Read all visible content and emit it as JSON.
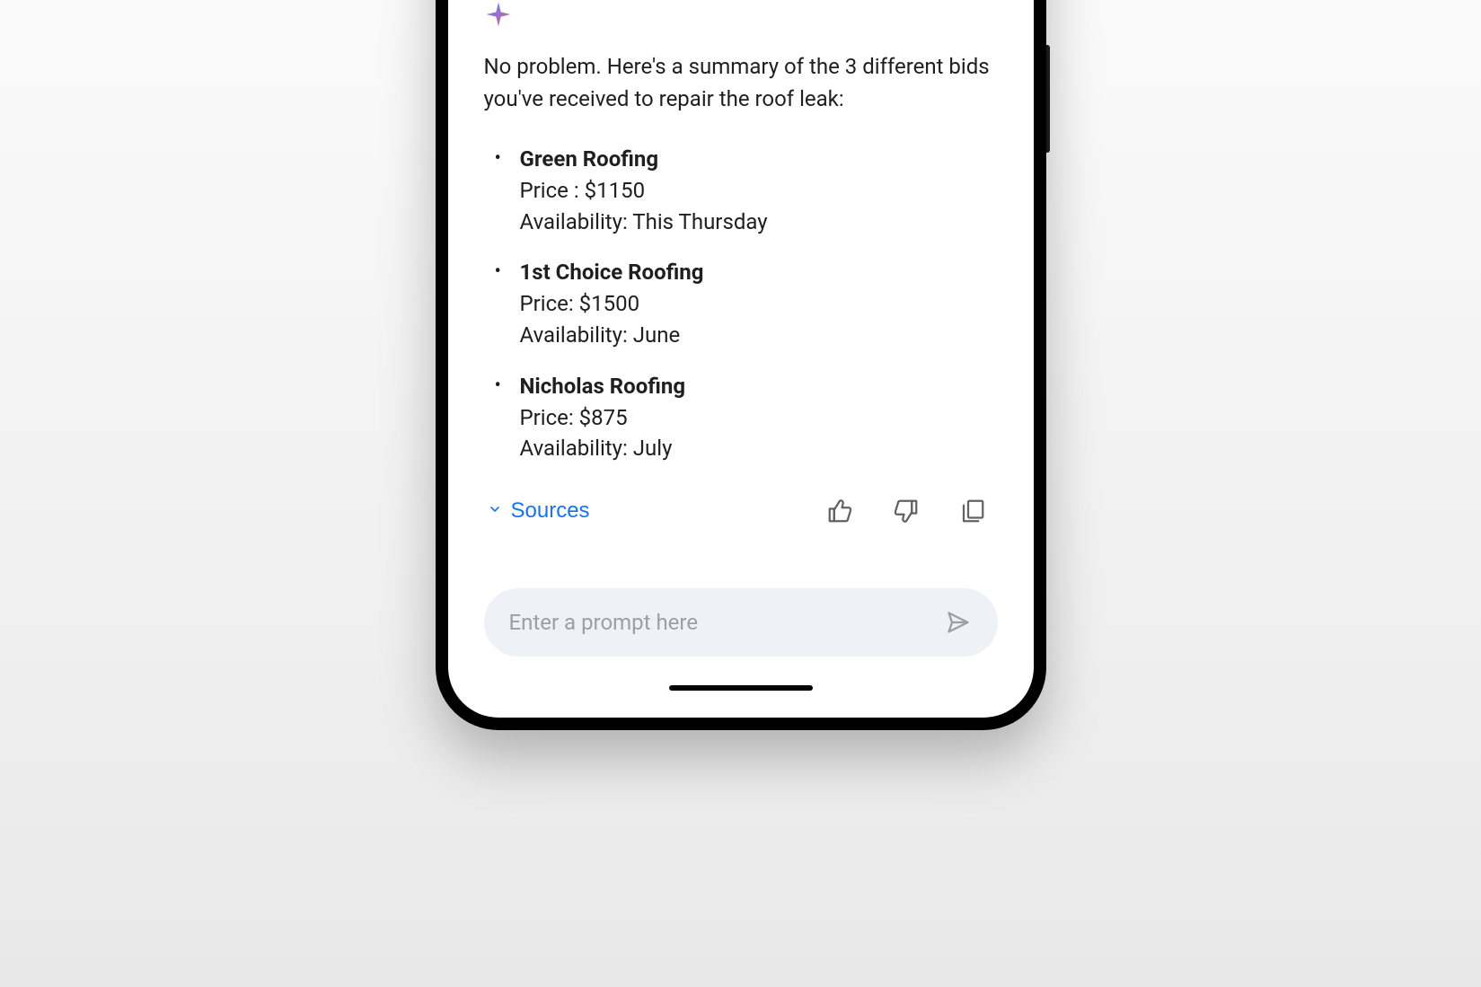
{
  "response": {
    "intro": "No problem. Here's a summary of the 3 different bids you've received to repair the roof leak:",
    "bids": [
      {
        "name": "Green Roofing",
        "price_label": "Price : $1150",
        "availability_label": "Availability: This Thursday"
      },
      {
        "name": "1st Choice Roofing",
        "price_label": "Price: $1500",
        "availability_label": "Availability: June"
      },
      {
        "name": "Nicholas Roofing",
        "price_label": "Price: $875",
        "availability_label": "Availability: July"
      }
    ]
  },
  "actions": {
    "sources_label": "Sources"
  },
  "prompt": {
    "placeholder": "Enter a prompt here"
  }
}
